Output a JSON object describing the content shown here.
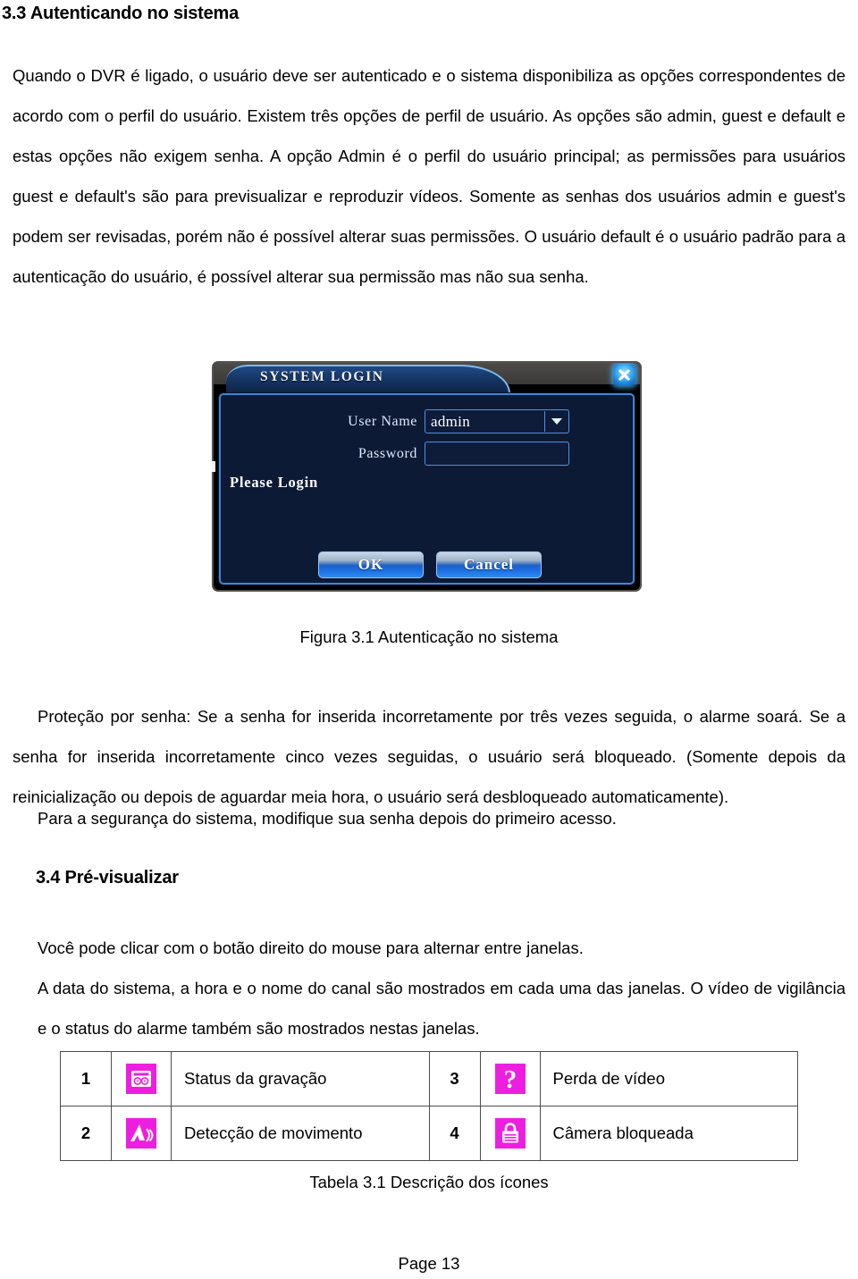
{
  "document": {
    "section_33_heading": "3.3 Autenticando no sistema",
    "section_34_heading": "3.4 Pré-visualizar",
    "paragraph_1": "Quando o DVR é ligado, o usuário deve ser autenticado e o sistema disponibiliza as opções correspondentes de acordo com o perfil do usuário. Existem três opções de perfil de usuário. As opções são admin, guest e default e estas opções não exigem senha. A opção Admin é o perfil do usuário principal; as permissões para usuários guest e default's são para previsualizar e reproduzir vídeos. Somente as senhas dos usuários admin e guest's podem ser revisadas, porém não é possível alterar suas permissões. O usuário default é o usuário padrão para a autenticação do usuário, é possível alterar sua permissão mas não sua senha.",
    "figure_caption": "Figura 3.1 Autenticação no sistema",
    "paragraph_2": "Proteção por senha: Se a senha for inserida incorretamente por três vezes seguida, o alarme soará. Se a senha for inserida incorretamente cinco vezes seguidas, o usuário será bloqueado. (Somente depois da reinicialização ou depois de aguardar meia hora, o usuário será desbloqueado automaticamente).",
    "paragraph_3": "Para a segurança do sistema, modifique sua senha depois do primeiro acesso.",
    "paragraph_4": "Você pode clicar com o botão direito do mouse para alternar entre janelas.",
    "paragraph_5": "A data do sistema, a hora e o nome do canal são mostrados em cada uma das janelas. O vídeo de vigilância e o status do alarme também são mostrados nestas janelas.",
    "table_caption": "Tabela 3.1 Descrição dos ícones",
    "page_number": "Page 13"
  },
  "figure": {
    "title": "SYSTEM LOGIN",
    "close_icon": "close-icon",
    "user_name_label": "User Name",
    "user_name_value": "admin",
    "user_name_dropdown_icon": "chevron-down-icon",
    "password_label": "Password",
    "password_value": "",
    "status_text": "Please Login",
    "ok_label": "OK",
    "cancel_label": "Cancel",
    "colors": {
      "dialog_background": "#0d1a36",
      "titlebar": "#14325f",
      "border_glow": "#3e86d8",
      "button_accent": "#1a6fe0",
      "close_button": "#36a8f0"
    }
  },
  "icon_table": {
    "accent_color": "#ee1ee1",
    "rows": [
      {
        "left_num": "1",
        "left_icon": "recording-status-icon",
        "left_desc": "Status da gravação",
        "right_num": "3",
        "right_icon": "video-loss-question-icon",
        "right_desc": "Perda de vídeo"
      },
      {
        "left_num": "2",
        "left_icon": "motion-detection-icon",
        "left_desc": "Detecção de movimento",
        "right_num": "4",
        "right_icon": "camera-blocked-lock-icon",
        "right_desc": "Câmera bloqueada"
      }
    ]
  }
}
